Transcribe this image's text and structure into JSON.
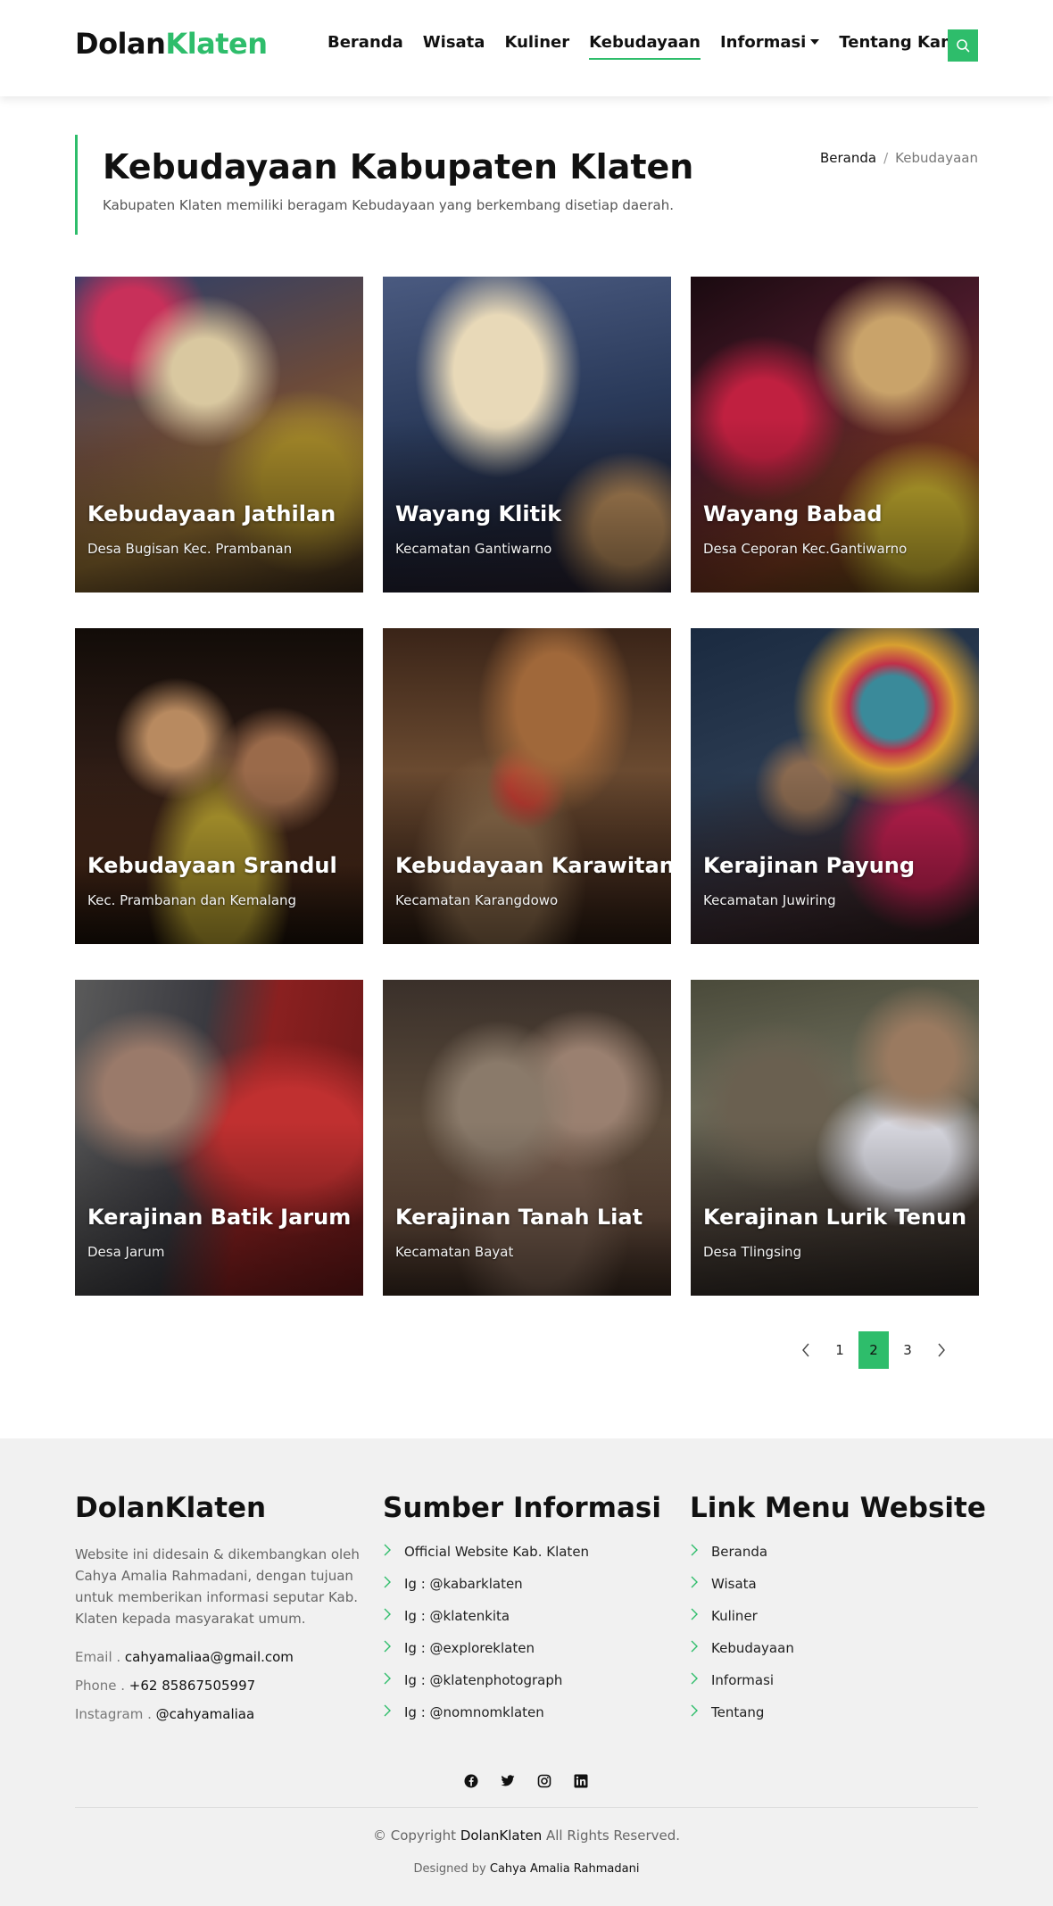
{
  "header": {
    "logo_dark": "Dolan",
    "logo_green": "Klaten",
    "nav": [
      {
        "label": "Beranda"
      },
      {
        "label": "Wisata"
      },
      {
        "label": "Kuliner"
      },
      {
        "label": "Kebudayaan"
      },
      {
        "label": "Informasi"
      },
      {
        "label": "Tentang Kami"
      }
    ],
    "search_icon": "search-icon"
  },
  "page": {
    "title": "Kebudayaan Kabupaten Klaten",
    "subtitle": "Kabupaten Klaten memiliki beragam Kebudayaan yang berkembang disetiap daerah.",
    "breadcrumb": {
      "home": "Beranda",
      "separator": "/",
      "current": "Kebudayaan"
    }
  },
  "cards": [
    {
      "title": "Kebudayaan Jathilan",
      "location": "Desa Bugisan Kec. Prambanan"
    },
    {
      "title": "Wayang Klitik",
      "location": "Kecamatan Gantiwarno"
    },
    {
      "title": "Wayang Babad",
      "location": "Desa Ceporan Kec.Gantiwarno"
    },
    {
      "title": "Kebudayaan Srandul",
      "location": "Kec. Prambanan dan Kemalang"
    },
    {
      "title": "Kebudayaan Karawitan",
      "location": "Kecamatan Karangdowo"
    },
    {
      "title": "Kerajinan Payung",
      "location": "Kecamatan Juwiring"
    },
    {
      "title": "Kerajinan Batik Jarum",
      "location": "Desa Jarum"
    },
    {
      "title": "Kerajinan Tanah Liat",
      "location": "Kecamatan Bayat"
    },
    {
      "title": "Kerajinan Lurik Tenun",
      "location": "Desa Tlingsing"
    }
  ],
  "pagination": {
    "pages": [
      "1",
      "2",
      "3"
    ],
    "current": "2"
  },
  "footer": {
    "about": {
      "title": "DolanKlaten",
      "text": "Website ini didesain & dikembangkan oleh Cahya Amalia Rahmadani, dengan tujuan untuk memberikan informasi seputar Kab. Klaten kepada masyarakat umum.",
      "email_label": "Email . ",
      "email": "cahyamaliaa@gmail.com",
      "phone_label": "Phone . ",
      "phone": "+62 85867505997",
      "instagram_label": "Instagram . ",
      "instagram": "@cahyamaliaa"
    },
    "sources": {
      "title": "Sumber Informasi",
      "items": [
        "Official Website Kab. Klaten",
        "Ig : @kabarklaten",
        "Ig : @klatenkita",
        "Ig : @exploreklaten",
        "Ig : @klatenphotograph",
        "Ig : @nomnomklaten"
      ]
    },
    "links": {
      "title": "Link Menu Website",
      "items": [
        "Beranda",
        "Wisata",
        "Kuliner",
        "Kebudayaan",
        "Informasi",
        "Tentang"
      ]
    },
    "social": [
      "facebook-icon",
      "twitter-icon",
      "instagram-icon",
      "linkedin-icon"
    ],
    "copyright_pre": "© Copyright ",
    "copyright_brand": "DolanKlaten",
    "copyright_post": " All Rights Reserved.",
    "designed_pre": "Designed by ",
    "designed_name": "Cahya Amalia Rahmadani"
  },
  "colors": {
    "accent": "#2ebd6b",
    "footer_bg": "#f1f1f1"
  }
}
